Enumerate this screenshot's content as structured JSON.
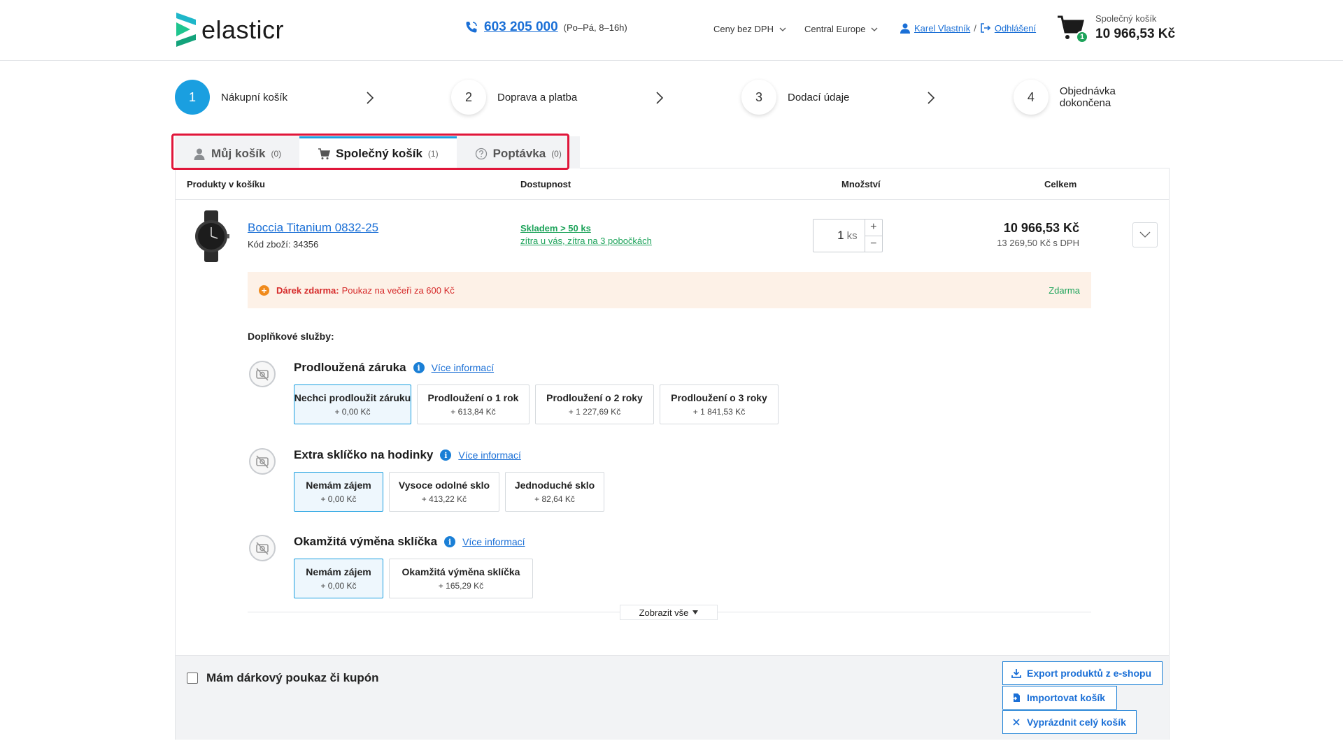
{
  "header": {
    "logo_text": "elasticr",
    "phone_number": "603 205 000",
    "phone_hours": "(Po–Pá, 8–16h)",
    "price_mode": "Ceny bez DPH",
    "region": "Central Europe",
    "user_name": "Karel Vlastník",
    "separator": "/",
    "logout": "Odhlášení",
    "cart_label": "Společný košík",
    "cart_total": "10 966,53 Kč",
    "cart_count": "1"
  },
  "steps": [
    {
      "number": "1",
      "label": "Nákupní košík"
    },
    {
      "number": "2",
      "label": "Doprava a platba"
    },
    {
      "number": "3",
      "label": "Dodací údaje"
    },
    {
      "number": "4",
      "label": "Objednávka dokončena"
    }
  ],
  "tabs": [
    {
      "label": "Můj košík",
      "count": "(0)"
    },
    {
      "label": "Společný košík",
      "count": "(1)"
    },
    {
      "label": "Poptávka",
      "count": "(0)"
    }
  ],
  "table": {
    "col_products": "Produkty v košíku",
    "col_availability": "Dostupnost",
    "col_quantity": "Množství",
    "col_total": "Celkem"
  },
  "product": {
    "name": "Boccia Titanium 0832-25",
    "code": "Kód zboží: 34356",
    "availability_main": "Skladem > 50 ks",
    "availability_detail": "zítra u vás, zítra na 3 pobočkách",
    "quantity": "1",
    "unit": "ks",
    "qty_plus": "+",
    "qty_minus": "−",
    "price": "10 966,53 Kč",
    "price_vat": "13 269,50 Kč s DPH"
  },
  "gift": {
    "label": "Dárek zdarma:",
    "description": "Poukaz na večeři za 600 Kč",
    "price": "Zdarma"
  },
  "services": {
    "title": "Doplňkové služby:",
    "more_info": "Více informací",
    "warranty": {
      "title": "Prodloužená záruka",
      "options": [
        {
          "name": "Nechci prodloužit záruku",
          "price": "+ 0,00 Kč"
        },
        {
          "name": "Prodloužení o 1 rok",
          "price": "+ 613,84 Kč"
        },
        {
          "name": "Prodloužení o 2 roky",
          "price": "+ 1 227,69 Kč"
        },
        {
          "name": "Prodloužení o 3 roky",
          "price": "+ 1 841,53 Kč"
        }
      ]
    },
    "glass": {
      "title": "Extra sklíčko na hodinky",
      "options": [
        {
          "name": "Nemám zájem",
          "price": "+ 0,00 Kč"
        },
        {
          "name": "Vysoce odolné sklo",
          "price": "+ 413,22 Kč"
        },
        {
          "name": "Jednoduché sklo",
          "price": "+ 82,64 Kč"
        }
      ]
    },
    "exchange": {
      "title": "Okamžitá výměna sklíčka",
      "options": [
        {
          "name": "Nemám zájem",
          "price": "+ 0,00 Kč"
        },
        {
          "name": "Okamžitá výměna sklíčka",
          "price": "+ 165,29 Kč"
        }
      ]
    },
    "show_all": "Zobrazit vše"
  },
  "footer": {
    "coupon_label": "Mám dárkový poukaz či kupón",
    "export_label": "Export produktů z e-shopu",
    "import_label": "Importovat košík",
    "empty_label": "Vyprázdnit celý košík"
  },
  "colors": {
    "accent": "#1a9fe0",
    "link": "#1a6fd6",
    "success": "#1da35a",
    "gift_bg": "#fdf1e7",
    "gift_text": "#d62b2b",
    "highlight_frame": "#e0163a"
  }
}
